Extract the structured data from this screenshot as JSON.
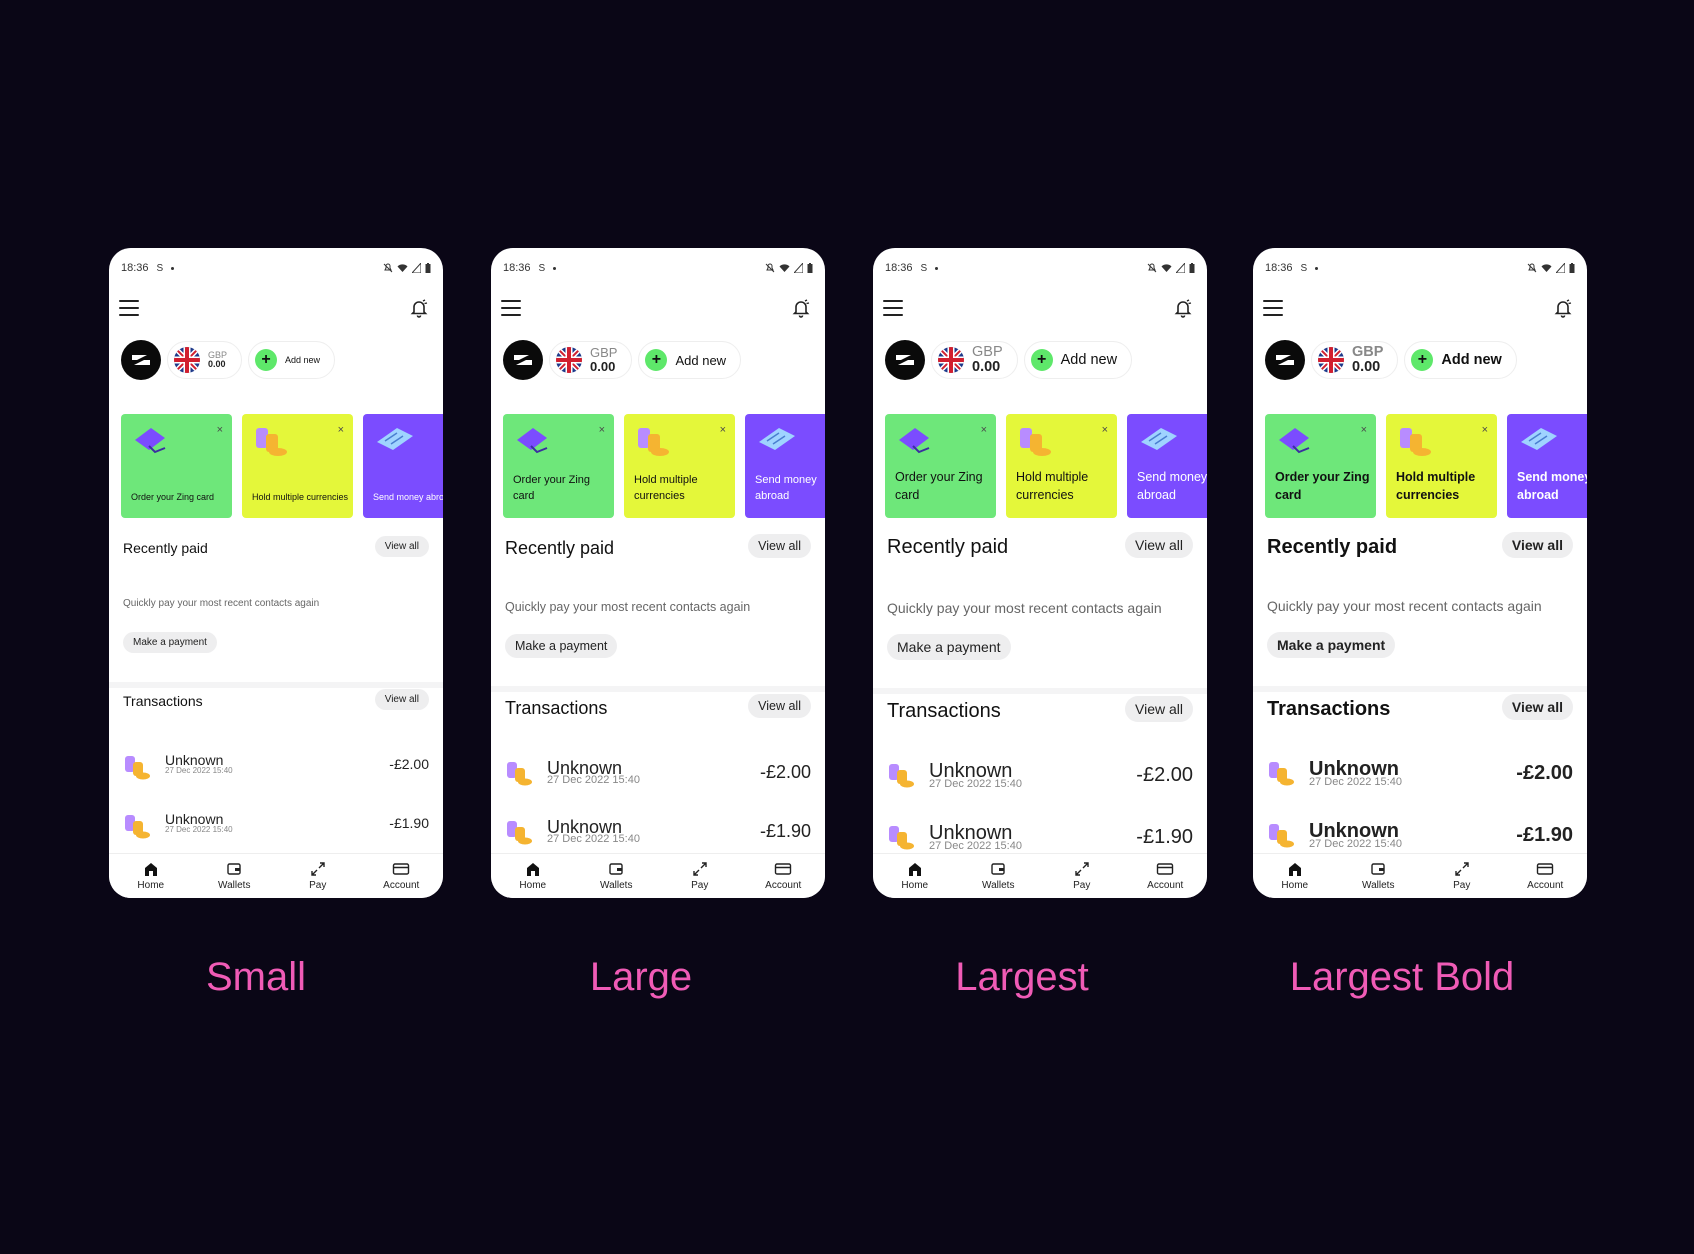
{
  "status": {
    "time": "18:36"
  },
  "wallet": {
    "currency": "GBP",
    "balance": "0.00",
    "add_label": "Add new"
  },
  "cards": [
    {
      "label": "Order your Zing card",
      "close": "×"
    },
    {
      "label": "Hold multiple currencies",
      "close": "×"
    },
    {
      "label": "Send money abroad"
    }
  ],
  "recently_paid": {
    "title": "Recently paid",
    "view_all": "View all",
    "hint": "Quickly pay your most recent contacts again",
    "cta": "Make a payment"
  },
  "transactions": {
    "title": "Transactions",
    "view_all": "View all",
    "items": [
      {
        "name": "Unknown",
        "date": "27 Dec 2022 15:40",
        "amount": "-£2.00"
      },
      {
        "name": "Unknown",
        "date": "27 Dec 2022 15:40",
        "amount": "-£1.90"
      }
    ]
  },
  "nav": [
    "Home",
    "Wallets",
    "Pay",
    "Account"
  ],
  "captions": [
    "Small",
    "Large",
    "Largest",
    "Largest Bold"
  ],
  "colors": {
    "background": "#0a0616",
    "caption": "#f05bb6",
    "green": "#6ee77a",
    "yellow": "#e4f73a",
    "purple": "#7b4cff"
  }
}
